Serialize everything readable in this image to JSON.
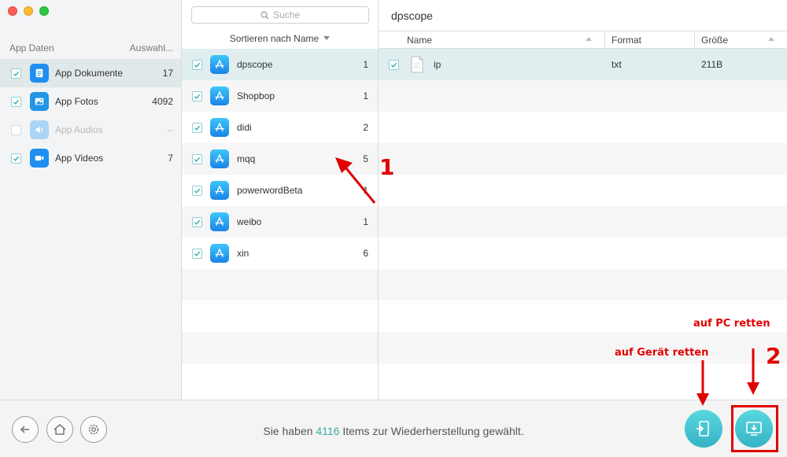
{
  "sidebar": {
    "header_left": "App Daten",
    "header_right": "Auswahl...",
    "items": [
      {
        "label": "App Dokumente",
        "count": "17",
        "icon": "document-icon",
        "color": "#1e8ef0",
        "checked": true,
        "active": true
      },
      {
        "label": "App Fotos",
        "count": "4092",
        "icon": "photo-icon",
        "color": "#2196e6",
        "checked": true
      },
      {
        "label": "App Audios",
        "count": "--",
        "icon": "audio-icon",
        "color": "#a9d4f5",
        "checked": false,
        "disabled": true
      },
      {
        "label": "App Videos",
        "count": "7",
        "icon": "video-icon",
        "color": "#1e8ef0",
        "checked": true
      }
    ]
  },
  "middle": {
    "search_placeholder": "Suche",
    "sort_label": "Sortieren nach Name",
    "apps": [
      {
        "name": "dpscope",
        "count": "1"
      },
      {
        "name": "Shopbop",
        "count": "1"
      },
      {
        "name": "didi",
        "count": "2"
      },
      {
        "name": "mqq",
        "count": "5"
      },
      {
        "name": "powerwordBeta",
        "count": "1"
      },
      {
        "name": "weibo",
        "count": "1"
      },
      {
        "name": "xin",
        "count": "6"
      }
    ]
  },
  "right": {
    "title": "dpscope",
    "columns": [
      "Name",
      "Format",
      "Größe"
    ],
    "files": [
      {
        "name": "ip",
        "format": "txt",
        "size": "211B"
      }
    ]
  },
  "footer": {
    "status_prefix": "Sie haben",
    "status_count": "4116",
    "status_suffix": "Items zur Wiederherstellung gewählt."
  },
  "annotations": {
    "step1": "1",
    "step2": "2",
    "device_label": "auf Gerät retten",
    "pc_label": "auf PC retten"
  },
  "colors": {
    "accent": "#3aa9ad",
    "annotation": "#e00000",
    "selection": "#e0eef0"
  }
}
